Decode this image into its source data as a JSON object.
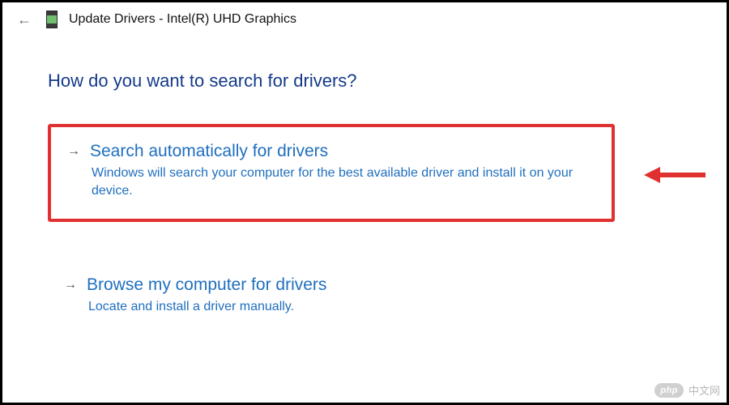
{
  "window": {
    "title": "Update Drivers - Intel(R) UHD Graphics"
  },
  "heading": "How do you want to search for drivers?",
  "options": [
    {
      "title": "Search automatically for drivers",
      "desc": "Windows will search your computer for the best available driver and install it on your device."
    },
    {
      "title": "Browse my computer for drivers",
      "desc": "Locate and install a driver manually."
    }
  ],
  "watermark": {
    "badge": "php",
    "text": "中文网"
  }
}
